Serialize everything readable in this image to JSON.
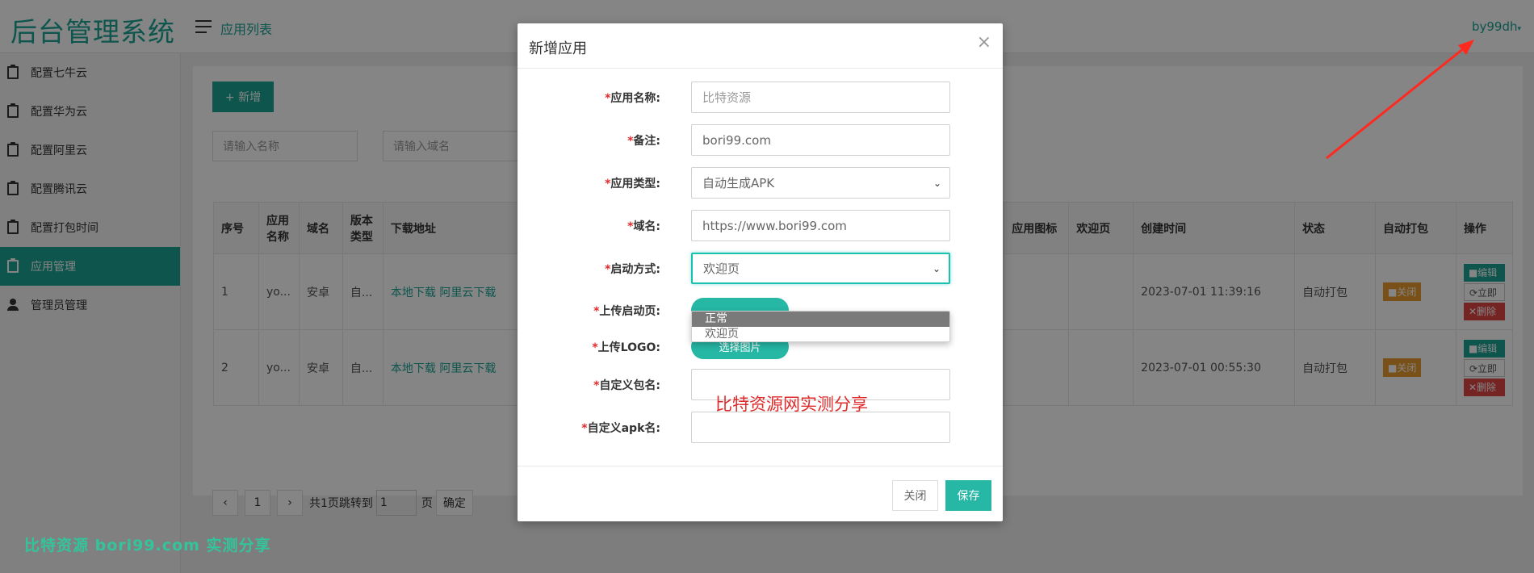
{
  "app": {
    "logo": "后台管理系统",
    "title": "应用列表",
    "user": "by99dh"
  },
  "sidebar": {
    "items": [
      {
        "label": "配置七牛云",
        "icon": "clipboard-icon",
        "active": false
      },
      {
        "label": "配置华为云",
        "icon": "clipboard-icon",
        "active": false
      },
      {
        "label": "配置阿里云",
        "icon": "clipboard-icon",
        "active": false
      },
      {
        "label": "配置腾讯云",
        "icon": "clipboard-icon",
        "active": false
      },
      {
        "label": "配置打包时间",
        "icon": "clipboard-icon",
        "active": false
      },
      {
        "label": "应用管理",
        "icon": "clipboard-icon",
        "active": true
      },
      {
        "label": "管理员管理",
        "icon": "person-icon",
        "active": false
      }
    ]
  },
  "toolbar": {
    "add_label": "+ 新增"
  },
  "filters": {
    "name_placeholder": "请输入名称",
    "domain_placeholder": "请输入域名"
  },
  "table": {
    "headers": [
      "序号",
      "应用名称",
      "域名",
      "版本类型",
      "下载地址",
      "应用图标",
      "欢迎页",
      "创建时间",
      "状态",
      "自动打包",
      "操作"
    ],
    "rows": [
      {
        "no": "1",
        "name": "yo...",
        "domain": "安卓",
        "type": "自...",
        "local_dl": "本地下载",
        "ali_dl": "阿里云下载",
        "created": "2023-07-01 11:39:16",
        "status": "自动打包",
        "auto_pack": "■关闭",
        "op_edit": "■编辑",
        "op_now": "⟳立即",
        "op_del": "✕删除"
      },
      {
        "no": "2",
        "name": "yo...",
        "domain": "安卓",
        "type": "自...",
        "local_dl": "本地下载",
        "ali_dl": "阿里云下载",
        "created": "2023-07-01 00:55:30",
        "status": "自动打包",
        "auto_pack": "■关闭",
        "op_edit": "■编辑",
        "op_now": "⟳立即",
        "op_del": "✕删除"
      }
    ]
  },
  "pager": {
    "prev": "‹",
    "page": "1",
    "next": "›",
    "summary": "共1页跳转到",
    "jump_value": "1",
    "page_unit": "页",
    "confirm": "确定"
  },
  "modal": {
    "title": "新增应用",
    "close": "×",
    "fields": {
      "app_name": {
        "label": "应用名称:",
        "placeholder": "比特资源"
      },
      "remark": {
        "label": "备注:",
        "value": "bori99.com"
      },
      "app_type": {
        "label": "应用类型:",
        "value": "自动生成APK"
      },
      "domain": {
        "label": "域名:",
        "value": "https://www.bori99.com"
      },
      "launch_mode": {
        "label": "启动方式:",
        "value": "欢迎页",
        "options": [
          "正常",
          "欢迎页"
        ]
      },
      "upload_launch": {
        "label": "上传启动页:"
      },
      "upload_logo": {
        "label": "上传LOGO:",
        "button": "选择图片"
      },
      "package_name": {
        "label": "自定义包名:",
        "value": ""
      },
      "apk_name": {
        "label": "自定义apk名:",
        "value": ""
      }
    },
    "overlay_text": "比特资源网实测分享",
    "cancel": "关闭",
    "save": "保存"
  },
  "watermark": "比特资源 bori99.com 实测分享",
  "colors": {
    "accent": "#19a394",
    "button": "#26b7a5",
    "danger": "#e02b2b",
    "warning": "#e89a2f",
    "annotation": "#ff2a1f"
  }
}
